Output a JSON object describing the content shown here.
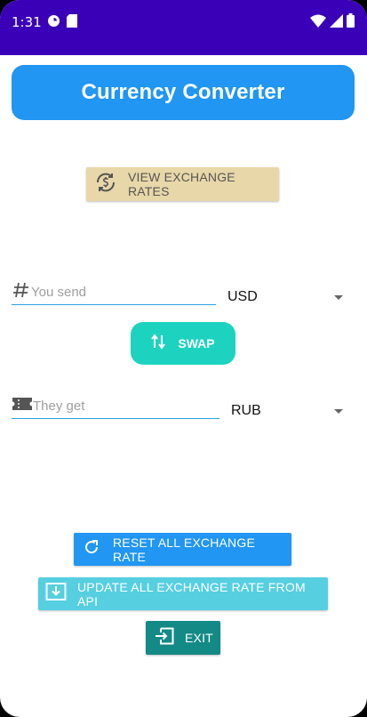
{
  "status_bar": {
    "time": "1:31"
  },
  "header": {
    "title": "Currency Converter"
  },
  "rates_button": {
    "label": "VIEW EXCHANGE RATES"
  },
  "send": {
    "placeholder": "You send",
    "currency": "USD"
  },
  "swap": {
    "label": "SWAP"
  },
  "receive": {
    "placeholder": "They get",
    "currency": "RUB"
  },
  "actions": {
    "reset_label": "RESET ALL EXCHANGE RATE",
    "update_label": "UPDATE ALL EXCHANGE RATE FROM API",
    "exit_label": "EXIT"
  },
  "colors": {
    "status_bar": "#3a00b8",
    "title_card": "#2196f3",
    "rates_button": "#e8d7a8",
    "swap_button": "#1dd3c0",
    "reset_button": "#2196f3",
    "update_button": "#56cfe1",
    "exit_button": "#138a86",
    "field_underline": "#2a9ee6"
  }
}
